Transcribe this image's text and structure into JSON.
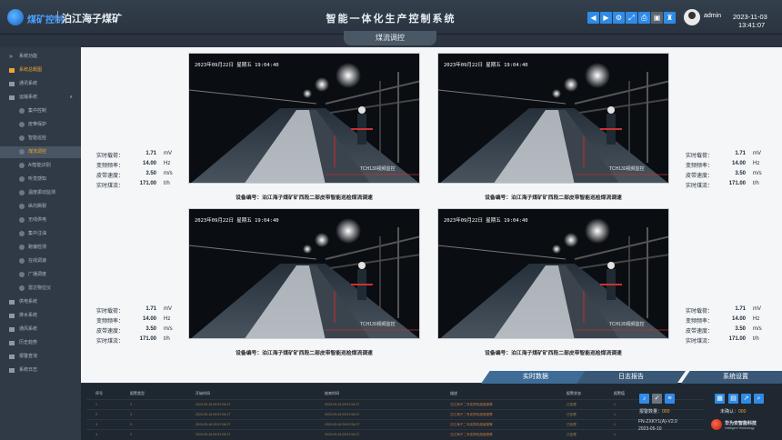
{
  "header": {
    "logo_text": "煤矿控制",
    "mine_name": "泊江海子煤矿",
    "title": "智能一体化生产控制系统",
    "toolbar": [
      {
        "name": "back-icon",
        "glyph": "◀"
      },
      {
        "name": "forward-icon",
        "glyph": "▶"
      },
      {
        "name": "gear-icon",
        "glyph": "⚙"
      },
      {
        "name": "expand-icon",
        "glyph": "⤢"
      },
      {
        "name": "print-icon",
        "glyph": "⎙"
      },
      {
        "name": "lock-icon",
        "glyph": "▣"
      },
      {
        "name": "shirt-icon",
        "glyph": "♜"
      }
    ],
    "user": "admin",
    "date": "2023-11-03",
    "time": "13:41:07"
  },
  "page_tab": "煤流调控",
  "sidebar": {
    "items": [
      {
        "label": "系统功能",
        "level": "top"
      },
      {
        "label": "系统总概图",
        "level": 1,
        "active": true
      },
      {
        "label": "通讯系统",
        "level": 1
      },
      {
        "label": "运输系统",
        "level": 1,
        "caret": "∧"
      },
      {
        "label": "集中控制",
        "level": 2
      },
      {
        "label": "皮带保护",
        "level": 2
      },
      {
        "label": "智能巡检",
        "level": 2
      },
      {
        "label": "煤流调控",
        "level": 2,
        "active": true
      },
      {
        "label": "AI智能识别",
        "level": 2
      },
      {
        "label": "听觉感知",
        "level": 2
      },
      {
        "label": "温度振动监测",
        "level": 2
      },
      {
        "label": "纵向撕裂",
        "level": 2
      },
      {
        "label": "无线供电",
        "level": 2
      },
      {
        "label": "集中注油",
        "level": 2
      },
      {
        "label": "跑偏检测",
        "level": 2
      },
      {
        "label": "在线调速",
        "level": 2
      },
      {
        "label": "广播调度",
        "level": 2
      },
      {
        "label": "雷达物位仪",
        "level": 2
      },
      {
        "label": "供电系统",
        "level": 1
      },
      {
        "label": "排水系统",
        "level": 1
      },
      {
        "label": "通风系统",
        "level": 1
      },
      {
        "label": "历史趋势",
        "level": 1
      },
      {
        "label": "报警查询",
        "level": 1
      },
      {
        "label": "系统日志",
        "level": 1
      }
    ]
  },
  "cameras": [
    {
      "timestamp": "2023年09月22日 星期五 19:04:40",
      "watermark": "TCH130视频监控",
      "caption": "设备编号：泊江海子煤矿矿西段二部皮带智能巡检煤流调速"
    },
    {
      "timestamp": "2023年09月22日 星期五 19:04:40",
      "watermark": "TCH130视频监控",
      "caption": "设备编号：泊江海子煤矿矿西段二部皮带智能巡检煤流调速"
    },
    {
      "timestamp": "2023年09月22日 星期五 19:04:40",
      "watermark": "TCH130视频监控",
      "caption": "设备编号：泊江海子煤矿矿西段二部皮带智能巡检煤流调速"
    },
    {
      "timestamp": "2023年09月22日 星期五 19:04:40",
      "watermark": "TCH130视频监控",
      "caption": "设备编号：泊江海子煤矿矿西段二部皮带智能巡检煤流调速"
    }
  ],
  "metrics": [
    [
      {
        "key": "实时载荷：",
        "value": "1.71",
        "unit": "mV"
      },
      {
        "key": "变频频率：",
        "value": "14.00",
        "unit": "Hz"
      },
      {
        "key": "皮带速度：",
        "value": "3.50",
        "unit": "m/s"
      },
      {
        "key": "实时煤流：",
        "value": "171.00",
        "unit": "t/h"
      }
    ],
    [
      {
        "key": "实时载荷：",
        "value": "1.71",
        "unit": "mV"
      },
      {
        "key": "变频频率：",
        "value": "14.00",
        "unit": "Hz"
      },
      {
        "key": "皮带速度：",
        "value": "3.50",
        "unit": "m/s"
      },
      {
        "key": "实时煤流：",
        "value": "171.00",
        "unit": "t/h"
      }
    ],
    [
      {
        "key": "实时载荷：",
        "value": "1.71",
        "unit": "mV"
      },
      {
        "key": "变频频率：",
        "value": "14.00",
        "unit": "Hz"
      },
      {
        "key": "皮带速度：",
        "value": "3.50",
        "unit": "m/s"
      },
      {
        "key": "实时煤流：",
        "value": "171.00",
        "unit": "t/h"
      }
    ],
    [
      {
        "key": "实时载荷：",
        "value": "1.71",
        "unit": "mV"
      },
      {
        "key": "变频频率：",
        "value": "14.00",
        "unit": "Hz"
      },
      {
        "key": "皮带速度：",
        "value": "3.50",
        "unit": "m/s"
      },
      {
        "key": "实时煤流：",
        "value": "171.00",
        "unit": "t/h"
      }
    ]
  ],
  "bottom_tabs": [
    "实时数据",
    "日志报告",
    "系统设置"
  ],
  "alarm_table": {
    "headers": [
      "序号",
      "报警类型",
      "开始时间",
      "结束时间",
      "描述",
      "报警状态",
      "报警值"
    ],
    "rows": [
      [
        "1",
        "3",
        "2023-09-16 09:57:06.27",
        "2023-09-16 09:57:06.27",
        "泊江海子二号皮带机超速报警",
        "已处理",
        "1"
      ],
      [
        "2",
        "3",
        "2023-09-16 09:57:06.27",
        "2023-09-16 09:57:06.27",
        "泊江海子二号皮带机超速报警",
        "已处理",
        "1"
      ],
      [
        "3",
        "3",
        "2023-09-16 09:57:06.27",
        "2023-09-16 09:57:06.27",
        "泊江海子二号皮带机超速报警",
        "已处理",
        "1"
      ],
      [
        "4",
        "3",
        "2023-09-16 09:57:06.27",
        "2023-09-16 09:57:06.27",
        "泊江海子二号皮带机超速报警",
        "已处理",
        "1"
      ]
    ]
  },
  "alarm_panel": {
    "count_label": "报警数量：",
    "count_value": "000",
    "unconfirmed_label": "未确认：",
    "unconfirmed_value": "000",
    "version": "FN-ZXKY1(A)-V2.0",
    "version_date": "2023-05-10",
    "brand_name": "华为安智能科技",
    "brand_sub": "Intelligent Technology"
  },
  "chart_data": {
    "type": "table",
    "title": "",
    "series": [
      {
        "name": "",
        "values": [
          1.71,
          14.0,
          3.5,
          171.0
        ]
      }
    ],
    "categories": [
      "实时载荷",
      "变频频率",
      "皮带速度",
      "实时煤流"
    ],
    "units": [
      "mV",
      "Hz",
      "m/s",
      "t/h"
    ]
  },
  "colors": {
    "accent": "#2f8be6",
    "active_text": "#f2a32c",
    "panel_dark": "#1f2731"
  }
}
